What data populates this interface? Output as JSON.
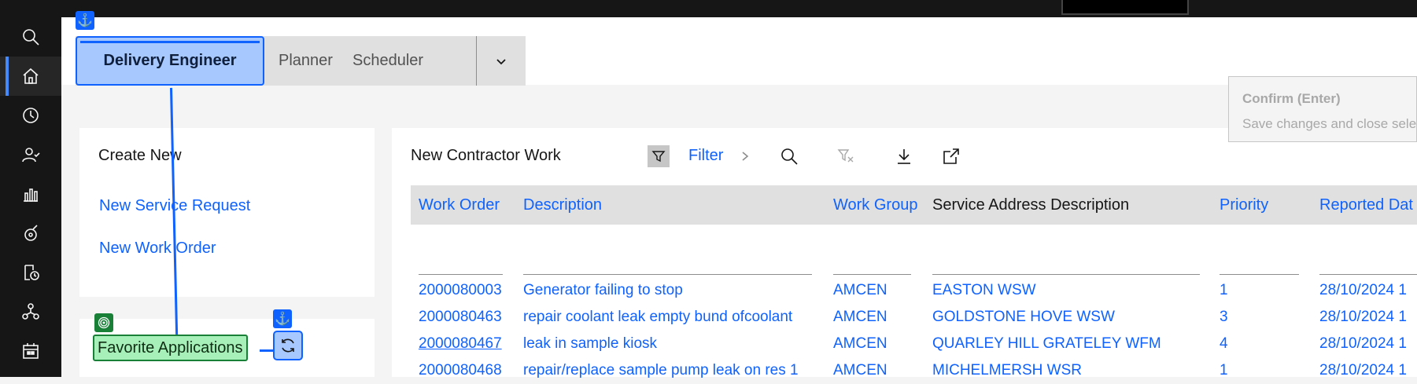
{
  "sidenav": {
    "items": [
      {
        "icon": "search-icon"
      },
      {
        "icon": "home-icon",
        "active": true
      },
      {
        "icon": "history-icon"
      },
      {
        "icon": "user-check-icon"
      },
      {
        "icon": "chart-icon"
      },
      {
        "icon": "asset-icon"
      },
      {
        "icon": "work-order-icon"
      },
      {
        "icon": "network-icon"
      },
      {
        "icon": "calendar-icon"
      }
    ]
  },
  "tabs": [
    {
      "label": "Delivery Engineer",
      "active": true
    },
    {
      "label": "Planner"
    },
    {
      "label": "Scheduler"
    }
  ],
  "create_new": {
    "title": "Create New",
    "links": [
      "New Service Request",
      "New Work Order"
    ]
  },
  "favorites": {
    "title": "Favorite Applications"
  },
  "tooltip": {
    "title": "Confirm (Enter)",
    "text": "Save changes and close sele"
  },
  "work_list": {
    "title": "New Contractor Work",
    "filter_label": "Filter",
    "columns": [
      "Work Order",
      "Description",
      "Work Group",
      "Service Address Description",
      "Priority",
      "Reported Dat"
    ],
    "rows": [
      [
        "2000080003",
        "Generator failing to stop",
        "AMCEN",
        "EASTON WSW",
        "1",
        "28/10/2024 1"
      ],
      [
        "2000080463",
        "repair coolant leak empty bund ofcoolant",
        "AMCEN",
        "GOLDSTONE HOVE WSW",
        "3",
        "28/10/2024 1"
      ],
      [
        "2000080467",
        "leak in sample kiosk",
        "AMCEN",
        "QUARLEY HILL GRATELEY WFM",
        "4",
        "28/10/2024 1"
      ],
      [
        "2000080468",
        "repair/replace sample pump leak on res 1",
        "AMCEN",
        "MICHELMERSH WSR",
        "1",
        "28/10/2024 1"
      ]
    ]
  },
  "colors": {
    "accent": "#0f62fe",
    "nav_bg": "#161616",
    "highlight_blue": "#a6c8ff",
    "highlight_green": "#a7f0ba"
  }
}
